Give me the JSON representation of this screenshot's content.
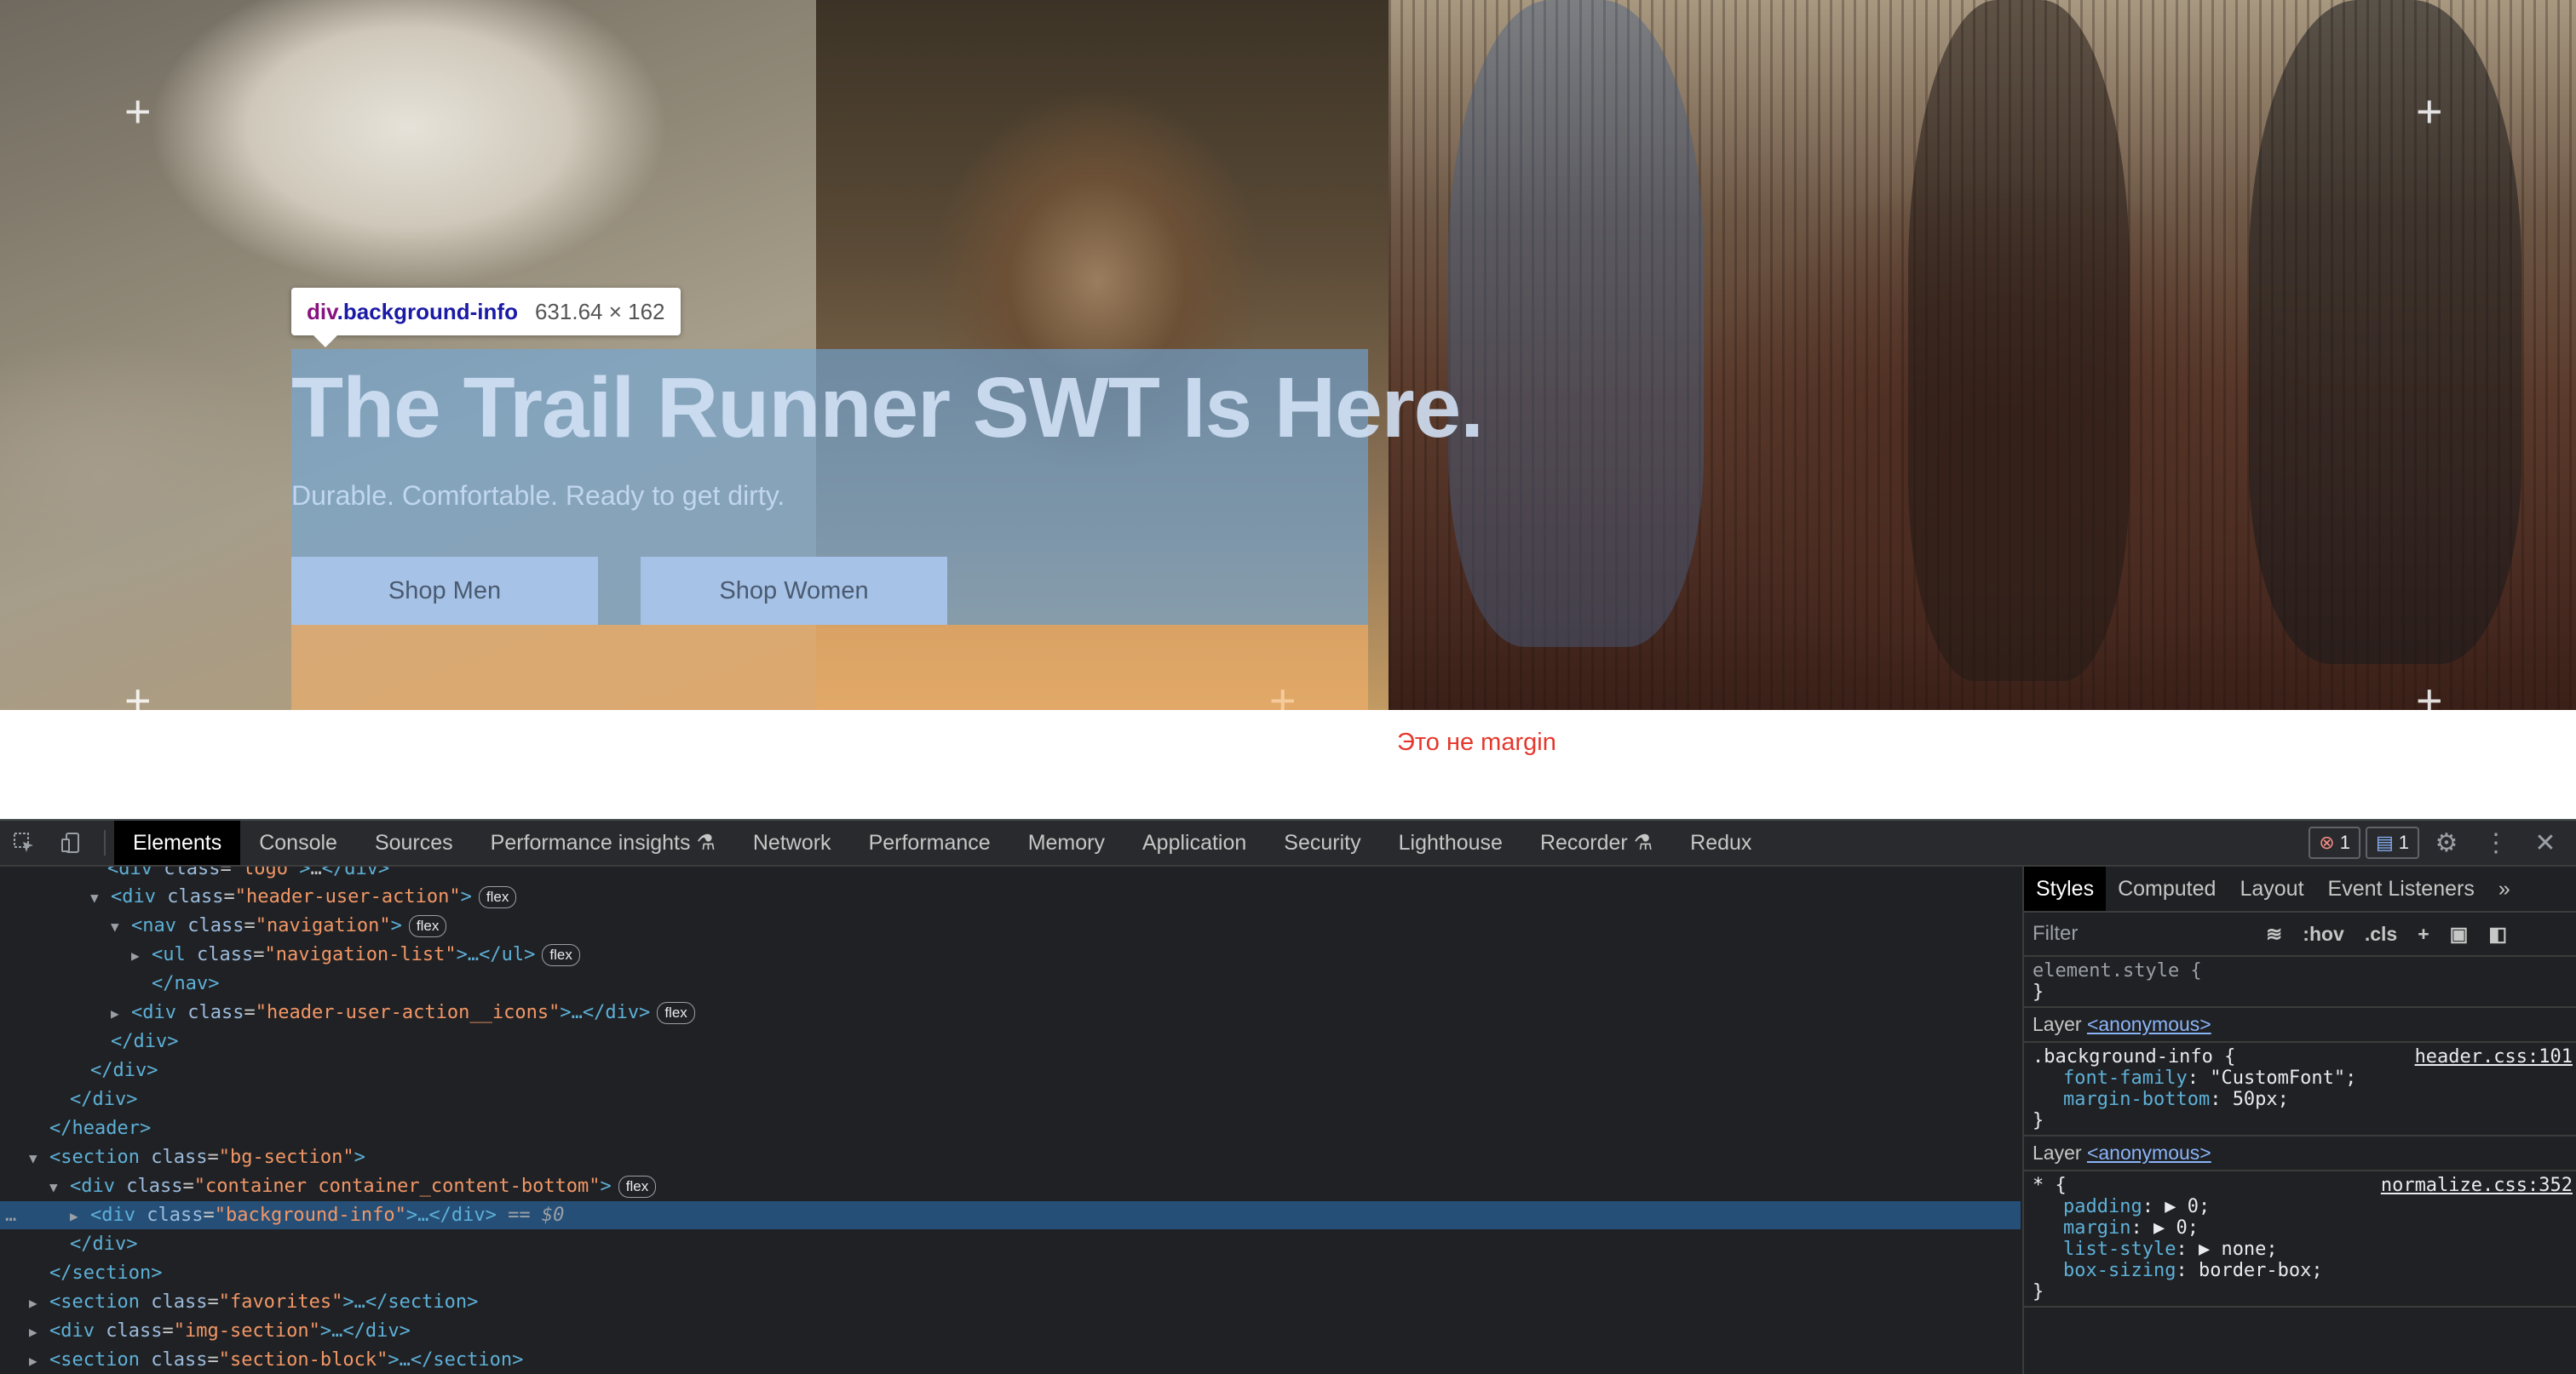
{
  "hero": {
    "tooltip_tag": "div",
    "tooltip_class": ".background-info",
    "tooltip_size": "631.64 × 162",
    "title": "The Trail Runner SWT Is Here.",
    "subtitle": "Durable. Comfortable. Ready to get dirty.",
    "btn_men": "Shop Men",
    "btn_women": "Shop Women",
    "plus": "+",
    "note": "Это не margin"
  },
  "devtools": {
    "tabs": [
      "Elements",
      "Console",
      "Sources",
      "Performance insights",
      "Network",
      "Performance",
      "Memory",
      "Application",
      "Security",
      "Lighthouse",
      "Recorder",
      "Redux"
    ],
    "flask": "⚗",
    "error_count": "1",
    "message_count": "1",
    "tree": [
      {
        "text_html": "<span class='tg'>&lt;div</span> <span class='an'>class</span>=<span class='av'>\"logo\"</span><span class='tg'>&gt;</span>…<span class='tg'>&lt;/div&gt;</span>"
      },
      {
        "tri": "▼",
        "open": "<div",
        "attr": "class",
        "val": "\"header-user-action\"",
        "close": ">",
        "pill": "flex"
      },
      {
        "tri": "▼",
        "open": "<nav",
        "attr": "class",
        "val": "\"navigation\"",
        "close": ">",
        "pill": "flex"
      },
      {
        "tri": "▶",
        "open": "<ul",
        "attr": "class",
        "val": "\"navigation-list\"",
        "close": ">…</ul>",
        "pill": "flex"
      },
      {
        "open": "</nav>"
      },
      {
        "tri": "▶",
        "open": "<div",
        "attr": "class",
        "val": "\"header-user-action__icons\"",
        "close": ">…</div>",
        "pill": "flex"
      },
      {
        "open": "</div>"
      },
      {
        "open": "</div>"
      },
      {
        "open": "</div>"
      },
      {
        "open": "</header>"
      },
      {
        "tri": "▼",
        "open": "<section",
        "attr": "class",
        "val": "\"bg-section\"",
        "close": ">"
      },
      {
        "tri": "▼",
        "open": "<div",
        "attr": "class",
        "val": "\"container container_content-bottom\"",
        "close": ">",
        "pill": "flex"
      },
      {
        "tri": "▶",
        "open": "<div",
        "attr": "class",
        "val": "\"background-info\"",
        "close": ">…</div>",
        "suffix": " == $0"
      },
      {
        "open": "</div>"
      },
      {
        "open": "</section>"
      },
      {
        "tri": "▶",
        "open": "<section",
        "attr": "class",
        "val": "\"favorites\"",
        "close": ">…</section>"
      },
      {
        "tri": "▶",
        "open": "<div",
        "attr": "class",
        "val": "\"img-section\"",
        "close": ">…</div>"
      },
      {
        "tri": "▶",
        "open": "<section",
        "attr": "class",
        "val": "\"section-block\"",
        "close": ">…</section>"
      },
      {
        "tri": "▶",
        "open": "<div",
        "attr": "class",
        "val": "\"img-section\"",
        "close": ">…</div>"
      }
    ],
    "selected_dots": "…",
    "styles": {
      "tabs": [
        "Styles",
        "Computed",
        "Layout",
        "Event Listeners"
      ],
      "more": "»",
      "filter_placeholder": "Filter",
      "hov": ":hov",
      "cls": ".cls",
      "element_style": "element.style {",
      "close_brace": "}",
      "layer_label": "Layer",
      "layer_link": "<anonymous>",
      "rule1_selector": ".background-info {",
      "rule1_source": "header.css:101",
      "rule1_props": [
        {
          "name": "font-family",
          "value": "\"CustomFont\";"
        },
        {
          "name": "margin-bottom",
          "value": "50px;"
        }
      ],
      "rule2_selector": "* {",
      "rule2_source": "normalize.css:352",
      "rule2_props": [
        {
          "name": "padding",
          "value": "▶ 0;"
        },
        {
          "name": "margin",
          "value": "▶ 0;"
        },
        {
          "name": "list-style",
          "value": "▶ none;"
        },
        {
          "name": "box-sizing",
          "value": "border-box;"
        }
      ]
    }
  },
  "colors": {
    "devtools_bg": "#202124",
    "selected_row": "#264f78",
    "highlight_content": "#6fa8dc",
    "note_red": "#e5372b"
  }
}
